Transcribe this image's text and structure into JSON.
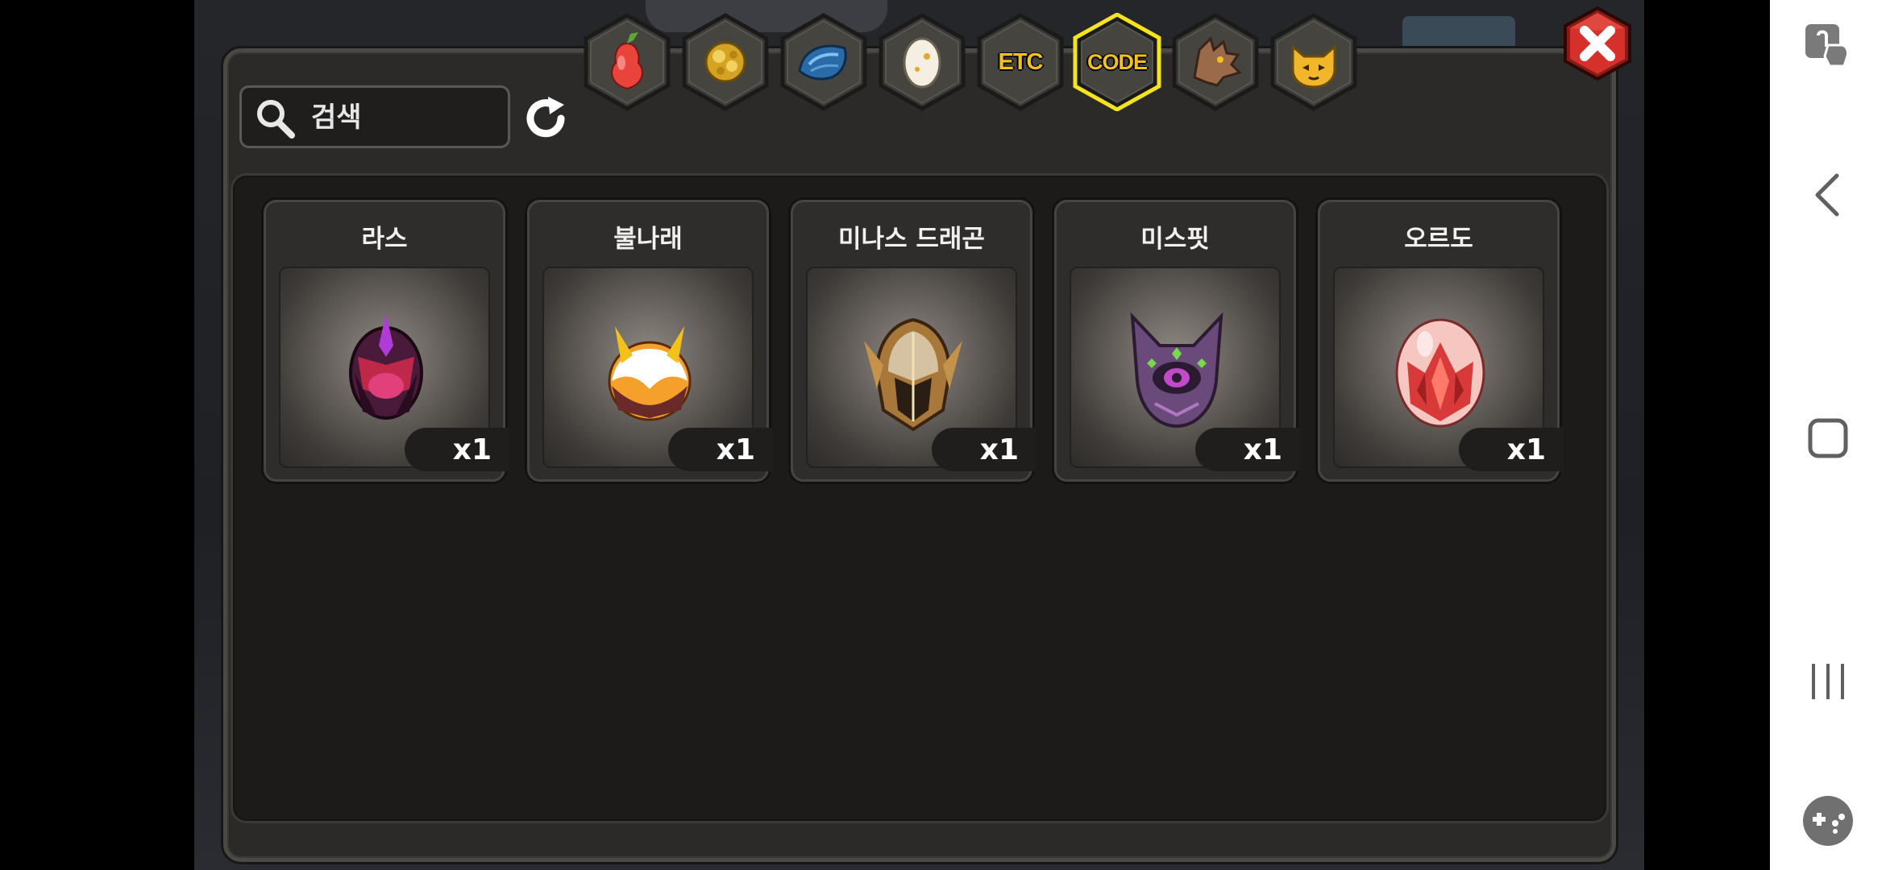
{
  "search": {
    "placeholder": "검색",
    "value": ""
  },
  "tabs": [
    {
      "id": "fruit",
      "icon": "pear-icon",
      "label": ""
    },
    {
      "id": "seed",
      "icon": "gold-ore-icon",
      "label": ""
    },
    {
      "id": "scale",
      "icon": "blue-scale-icon",
      "label": ""
    },
    {
      "id": "egg",
      "icon": "egg-icon",
      "label": ""
    },
    {
      "id": "etc",
      "icon": "",
      "label": "ETC"
    },
    {
      "id": "code",
      "icon": "",
      "label": "CODE",
      "selected": true
    },
    {
      "id": "dragon",
      "icon": "dragon-head-icon",
      "label": ""
    },
    {
      "id": "cat",
      "icon": "cat-face-icon",
      "label": ""
    }
  ],
  "items": [
    {
      "name": "라스",
      "count": "x1",
      "icon": "dark-egg-icon"
    },
    {
      "name": "불나래",
      "count": "x1",
      "icon": "flame-egg-icon"
    },
    {
      "name": "미나스 드래곤",
      "count": "x1",
      "icon": "helmet-icon"
    },
    {
      "name": "미스핏",
      "count": "x1",
      "icon": "purple-cat-icon"
    },
    {
      "name": "오르도",
      "count": "x1",
      "icon": "crystal-egg-icon"
    }
  ],
  "colors": {
    "tab_selected_border": "#f5e41b",
    "tab_label": "#f2c21b",
    "close_button": "#cf2a24",
    "panel": "#2b2a28"
  }
}
